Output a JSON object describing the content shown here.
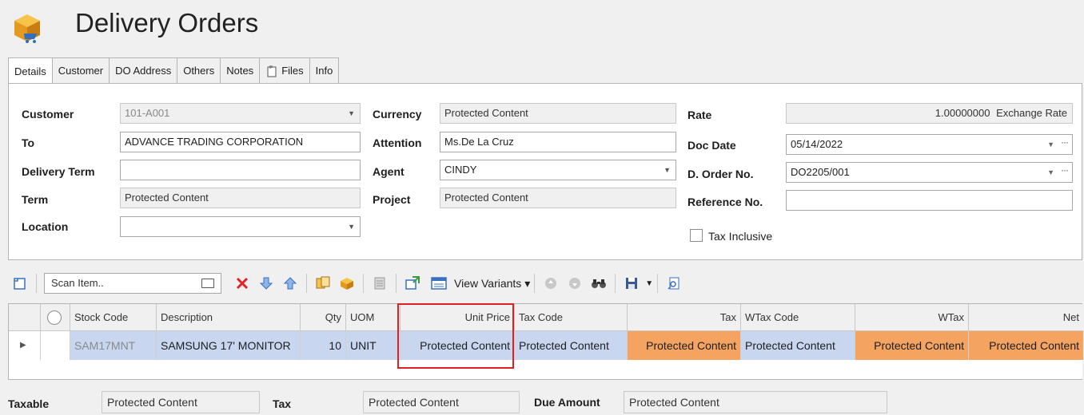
{
  "app": {
    "title": "Delivery Orders",
    "icon": "box-cart-icon"
  },
  "tabs": [
    {
      "label": "Details",
      "active": true
    },
    {
      "label": "Customer"
    },
    {
      "label": "DO Address"
    },
    {
      "label": "Others"
    },
    {
      "label": "Notes"
    },
    {
      "label": "Files",
      "icon": "files-icon"
    },
    {
      "label": "Info"
    }
  ],
  "form": {
    "customer": {
      "label": "Customer",
      "value": "101-A001"
    },
    "to": {
      "label": "To",
      "value": "ADVANCE TRADING CORPORATION"
    },
    "delivery_term": {
      "label": "Delivery Term",
      "value": ""
    },
    "term": {
      "label": "Term",
      "value": "Protected Content"
    },
    "location": {
      "label": "Location",
      "value": ""
    },
    "currency": {
      "label": "Currency",
      "value": "Protected Content"
    },
    "attention": {
      "label": "Attention",
      "value": "Ms.De La Cruz"
    },
    "agent": {
      "label": "Agent",
      "value": "CINDY"
    },
    "project": {
      "label": "Project",
      "value": "Protected Content"
    },
    "rate": {
      "label": "Rate",
      "value": "1.00000000",
      "suffix": "Exchange Rate"
    },
    "doc_date": {
      "label": "Doc Date",
      "value": "05/14/2022"
    },
    "d_order_no": {
      "label": "D. Order No.",
      "value": "DO2205/001"
    },
    "reference_no": {
      "label": "Reference No.",
      "value": ""
    },
    "tax_inclusive": {
      "label": "Tax Inclusive",
      "checked": false
    }
  },
  "toolbar": {
    "scan_placeholder": "Scan Item..",
    "view_variants_label": "View Variants"
  },
  "grid": {
    "columns": [
      "Stock Code",
      "Description",
      "Qty",
      "UOM",
      "Unit Price",
      "Tax Code",
      "Tax",
      "WTax Code",
      "WTax",
      "Net"
    ],
    "rows": [
      {
        "stock_code": "SAM17MNT",
        "description": "SAMSUNG 17' MONITOR",
        "qty": "10",
        "uom": "UNIT",
        "unit_price": "Protected Content",
        "tax_code": "Protected Content",
        "tax": "Protected Content",
        "wtax_code": "Protected Content",
        "wtax": "Protected Content",
        "net": "Protected Content"
      }
    ]
  },
  "footer": {
    "taxable": {
      "label": "Taxable",
      "value": "Protected Content"
    },
    "tax": {
      "label": "Tax",
      "value": "Protected Content"
    },
    "due_amount": {
      "label": "Due Amount",
      "value": "Protected Content"
    }
  },
  "colors": {
    "selected_row": "#c8d6f0",
    "protected_cell": "#f4a460",
    "highlight": "#e02020"
  }
}
